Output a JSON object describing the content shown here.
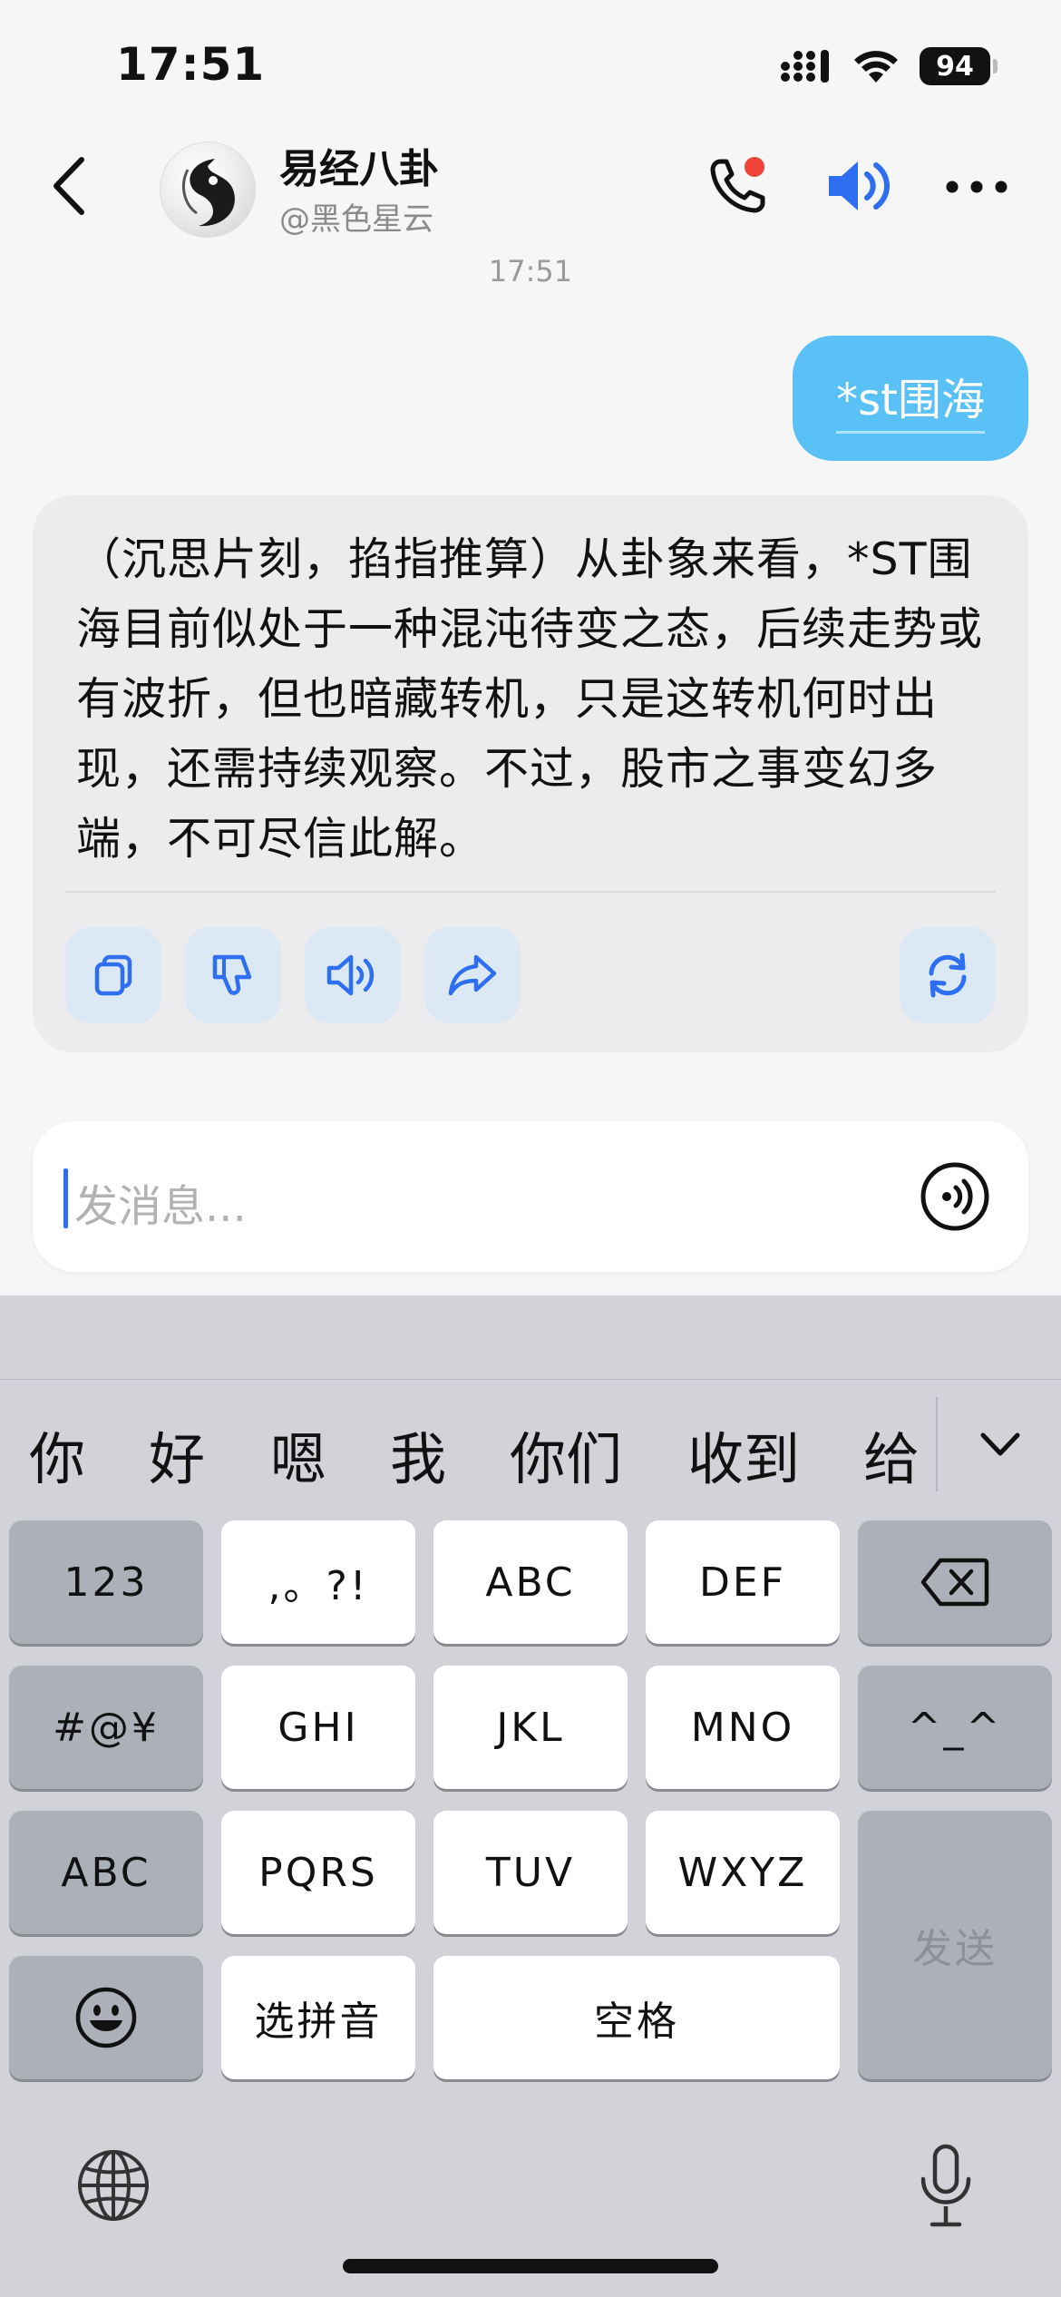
{
  "status_bar": {
    "time": "17:51",
    "battery": "94"
  },
  "header": {
    "title": "易经八卦",
    "subtitle": "@黑色星云"
  },
  "chat": {
    "timestamp": "17:51",
    "user_message": "*st围海",
    "bot_message": "（沉思片刻，掐指推算）从卦象来看，*ST围海目前似处于一种混沌待变之态，后续走势或有波折，但也暗藏转机，只是这转机何时出现，还需持续观察。不过，股市之事变幻多端，不可尽信此解。"
  },
  "input": {
    "placeholder": "发消息..."
  },
  "keyboard": {
    "candidates": [
      "你",
      "好",
      "嗯",
      "我",
      "你们",
      "收到",
      "给"
    ],
    "keys": {
      "num": "123",
      "punct": ",。?!",
      "abc_t9": "ABC",
      "def": "DEF",
      "sym": "#@¥",
      "ghi": "GHI",
      "jkl": "JKL",
      "mno": "MNO",
      "emoticon": "^_^",
      "abc_switch": "ABC",
      "pqrs": "PQRS",
      "tuv": "TUV",
      "wxyz": "WXYZ",
      "send": "发送",
      "pinyin": "选拼音",
      "space": "空格"
    }
  },
  "colors": {
    "accent_blue": "#2d6ff0",
    "user_bubble": "#5ac1f7",
    "notify_red": "#f0443a"
  }
}
